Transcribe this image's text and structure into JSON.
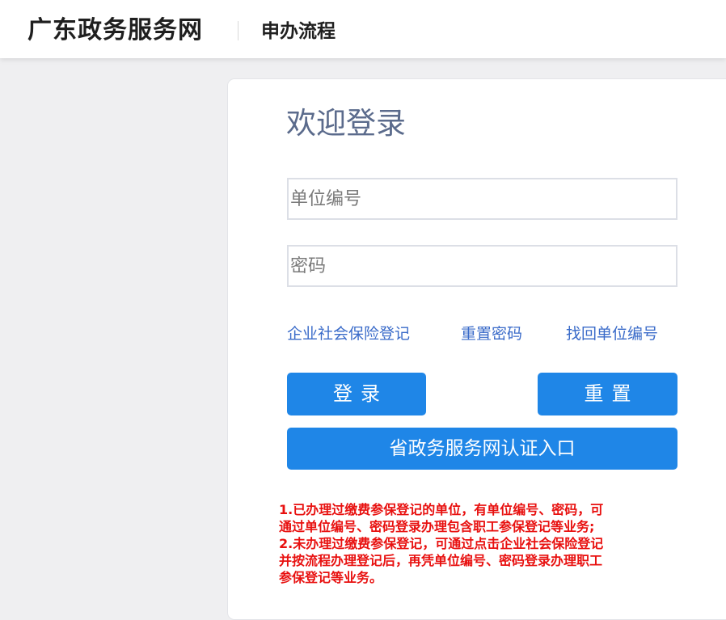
{
  "header": {
    "site_title": "广东政务服务网",
    "section_title": "申办流程"
  },
  "login": {
    "welcome": "欢迎登录",
    "unit_placeholder": "单位编号",
    "unit_value": "",
    "password_placeholder": "密码",
    "password_value": "",
    "links": {
      "register": "企业社会保险登记",
      "reset_password": "重置密码",
      "recover_unit_id": "找回单位编号"
    },
    "buttons": {
      "login": "登录",
      "reset": "重置",
      "gov_auth": "省政务服务网认证入口"
    },
    "notice_lines": [
      "1.已办理过缴费参保登记的单位，有单位编号、密码，可",
      "通过单位编号、密码登录办理包含职工参保登记等业务;",
      "2.未办理过缴费参保登记，可通过点击企业社会保险登记",
      "并按流程办理登记后，再凭单位编号、密码登录办理职工",
      "参保登记等业务。"
    ]
  },
  "colors": {
    "primary_button": "#1f86e7",
    "link": "#3a6bc9",
    "notice": "#e8100f",
    "welcome_text": "#5b6b8c"
  }
}
